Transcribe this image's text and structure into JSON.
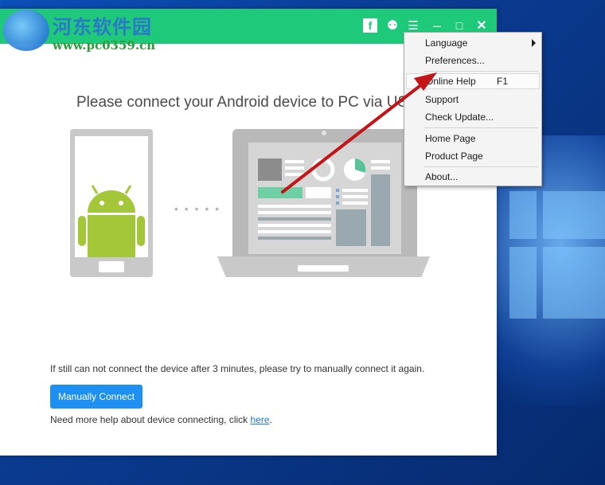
{
  "watermark": {
    "site": "河东软件园",
    "url": "www.pc0359.cn"
  },
  "window": {
    "title_icons": [
      "facebook-icon",
      "chat-icon",
      "menu-icon",
      "minimize-icon",
      "maximize-icon",
      "close-icon"
    ],
    "icons": {
      "facebook": "f",
      "chat": "⚉",
      "menu": "☰",
      "minimize": "–",
      "maximize": "□",
      "close": "✕"
    },
    "accent": "#1fc97a"
  },
  "main": {
    "title": "Please connect your Android device to PC via USB",
    "info": "If still can not connect the device after 3 minutes, please try to manually connect it again.",
    "manual_button": "Manually Connect",
    "help_prefix": "Need more help about device connecting, click ",
    "help_link": "here",
    "help_suffix": ".",
    "connector_dots": "• • • • •"
  },
  "menu": {
    "items": [
      {
        "label": "Language",
        "has_submenu": true
      },
      {
        "label": "Preferences..."
      },
      {
        "label": "Online Help",
        "shortcut": "F1",
        "highlighted": true
      },
      {
        "label": "Support"
      },
      {
        "label": "Check Update..."
      },
      {
        "label": "Home Page"
      },
      {
        "label": "Product Page"
      },
      {
        "label": "About..."
      }
    ]
  },
  "colors": {
    "button": "#1e90f2",
    "arrow": "#e0191c",
    "android": "#a4c639"
  }
}
